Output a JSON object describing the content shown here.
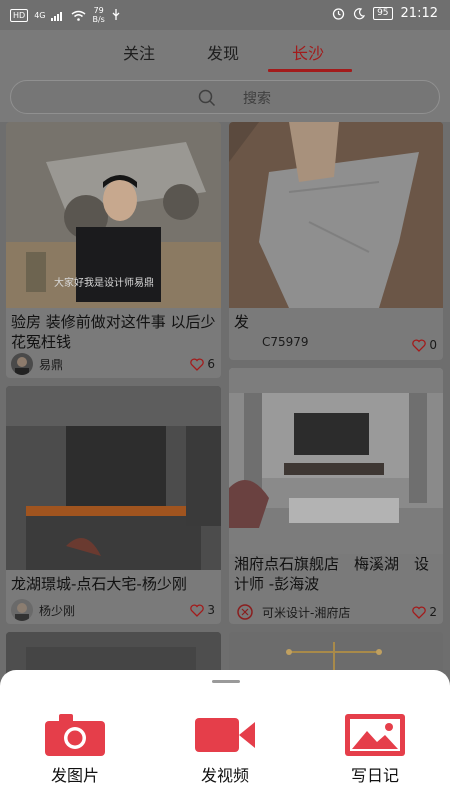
{
  "status_bar": {
    "hd_tag": "HD",
    "network": "4G",
    "speed_value": "79",
    "speed_unit": "B/s",
    "battery": "95",
    "time": "21:12"
  },
  "tabs": [
    {
      "label": "关注",
      "active": false
    },
    {
      "label": "发现",
      "active": false
    },
    {
      "label": "长沙",
      "active": true
    }
  ],
  "search": {
    "placeholder": "搜索",
    "icon": "search-icon"
  },
  "feed": {
    "cards": [
      {
        "title": "验房 装修前做对这件事 以后少花冤枉钱",
        "overlay_text": "大家好我是设计师易鼎",
        "author": "易鼎",
        "likes": "6"
      },
      {
        "title": "发",
        "author": "C75979",
        "likes": "0"
      },
      {
        "title": "龙湖璟城-点石大宅-杨少刚",
        "author": "杨少刚",
        "likes": "3"
      },
      {
        "title": "湘府点石旗舰店　梅溪湖　设计师 -彭海波",
        "author": "可米设计-湘府店",
        "likes": "2"
      }
    ]
  },
  "bottom_sheet": {
    "actions": [
      {
        "label": "发图片",
        "icon": "camera-icon"
      },
      {
        "label": "发视频",
        "icon": "video-camera-icon"
      },
      {
        "label": "写日记",
        "icon": "picture-icon"
      }
    ]
  },
  "colors": {
    "accent": "#e53e4a",
    "tab_active": "#a31b1b",
    "dim_overlay": "#000000"
  }
}
